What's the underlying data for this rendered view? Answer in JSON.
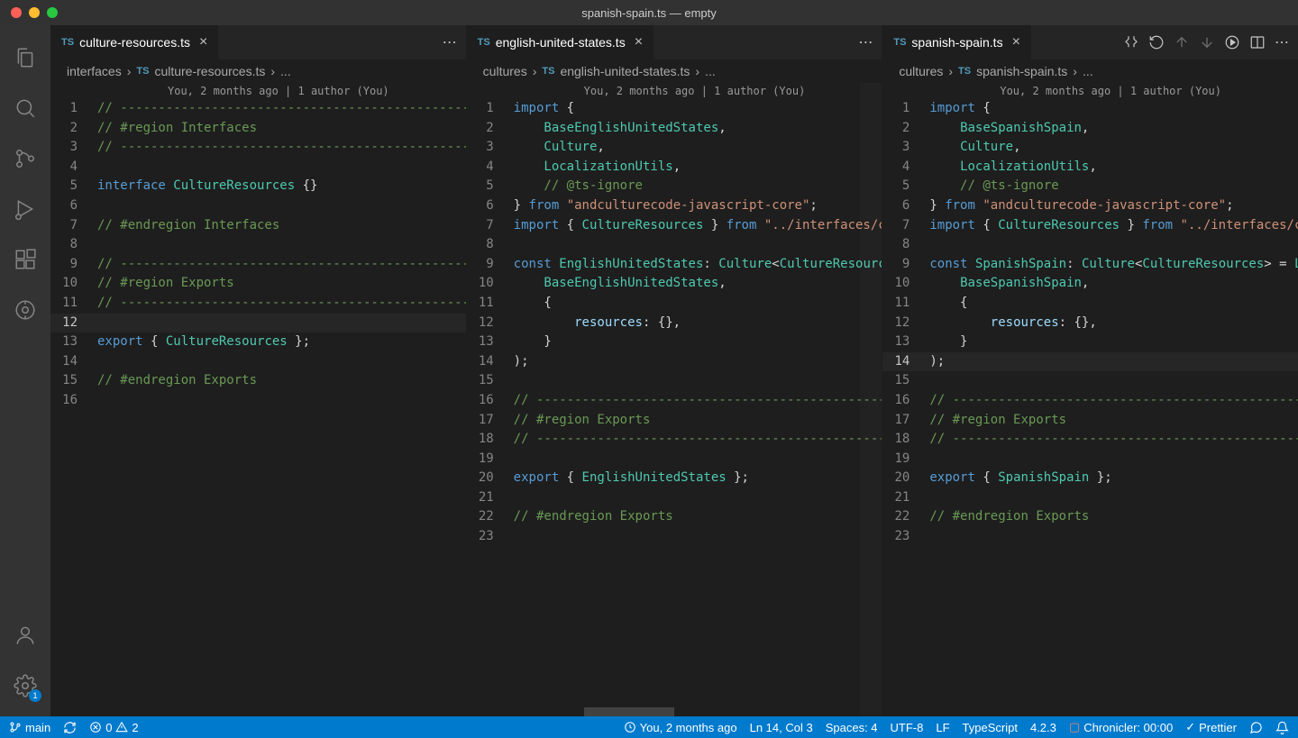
{
  "titlebar": "spanish-spain.ts — empty",
  "tabs": {
    "left": {
      "file": "culture-resources.ts"
    },
    "mid": {
      "file": "english-united-states.ts"
    },
    "right": {
      "file": "spanish-spain.ts"
    }
  },
  "breadcrumbs": {
    "left": {
      "folder": "interfaces",
      "file": "culture-resources.ts",
      "dots": "..."
    },
    "mid": {
      "folder": "cultures",
      "file": "english-united-states.ts",
      "dots": "..."
    },
    "right": {
      "folder": "cultures",
      "file": "spanish-spain.ts",
      "dots": "..."
    }
  },
  "codelens": "You, 2 months ago | 1 author (You)",
  "leftLines": [
    "// -----------------------------------------------------------------------------------",
    "// #region Interfaces",
    "// -----------------------------------------------------------------------------------",
    "",
    "interface CultureResources {}",
    "",
    "// #endregion Interfaces",
    "",
    "// -----------------------------------------------------------------------------------",
    "// #region Exports",
    "// -----------------------------------------------------------------------------------",
    "",
    "export { CultureResources };",
    "",
    "// #endregion Exports",
    ""
  ],
  "midLines": [
    "import {",
    "    BaseEnglishUnitedStates,",
    "    Culture,",
    "    LocalizationUtils,",
    "    // @ts-ignore",
    "} from \"andculturecode-javascript-core\";",
    "import { CultureResources } from \"../interfaces/culture-resources\";",
    "",
    "const EnglishUnitedStates: Culture<CultureResources> = LocalizationUtils.cultureFactory(",
    "    BaseEnglishUnitedStates,",
    "    {",
    "        resources: {},",
    "    }",
    ");",
    "",
    "// -----------------------------------------------------------------------------------",
    "// #region Exports",
    "// -----------------------------------------------------------------------------------",
    "",
    "export { EnglishUnitedStates };",
    "",
    "// #endregion Exports",
    ""
  ],
  "rightLines": [
    "import {",
    "    BaseSpanishSpain,",
    "    Culture,",
    "    LocalizationUtils,",
    "    // @ts-ignore",
    "} from \"andculturecode-javascript-core\";",
    "import { CultureResources } from \"../interfaces/culture-resources\";",
    "",
    "const SpanishSpain: Culture<CultureResources> = LocalizationUtils.cultureFactory(",
    "    BaseSpanishSpain,",
    "    {",
    "        resources: {},",
    "    }",
    ");",
    "",
    "// -----------------------------------------------------------------------------------",
    "// #region Exports",
    "// -----------------------------------------------------------------------------------",
    "",
    "export { SpanishSpain };",
    "",
    "// #endregion Exports",
    ""
  ],
  "rightCurrentLine": 14,
  "leftCurrentLine": 12,
  "activityBadge": "1",
  "status": {
    "branch": "main",
    "errors": "0",
    "warnings": "2",
    "blame": "You, 2 months ago",
    "pos": "Ln 14, Col 3",
    "spaces": "Spaces: 4",
    "encoding": "UTF-8",
    "eol": "LF",
    "lang": "TypeScript",
    "tsver": "4.2.3",
    "chronicler": "Chronicler: 00:00",
    "prettier": "Prettier"
  }
}
